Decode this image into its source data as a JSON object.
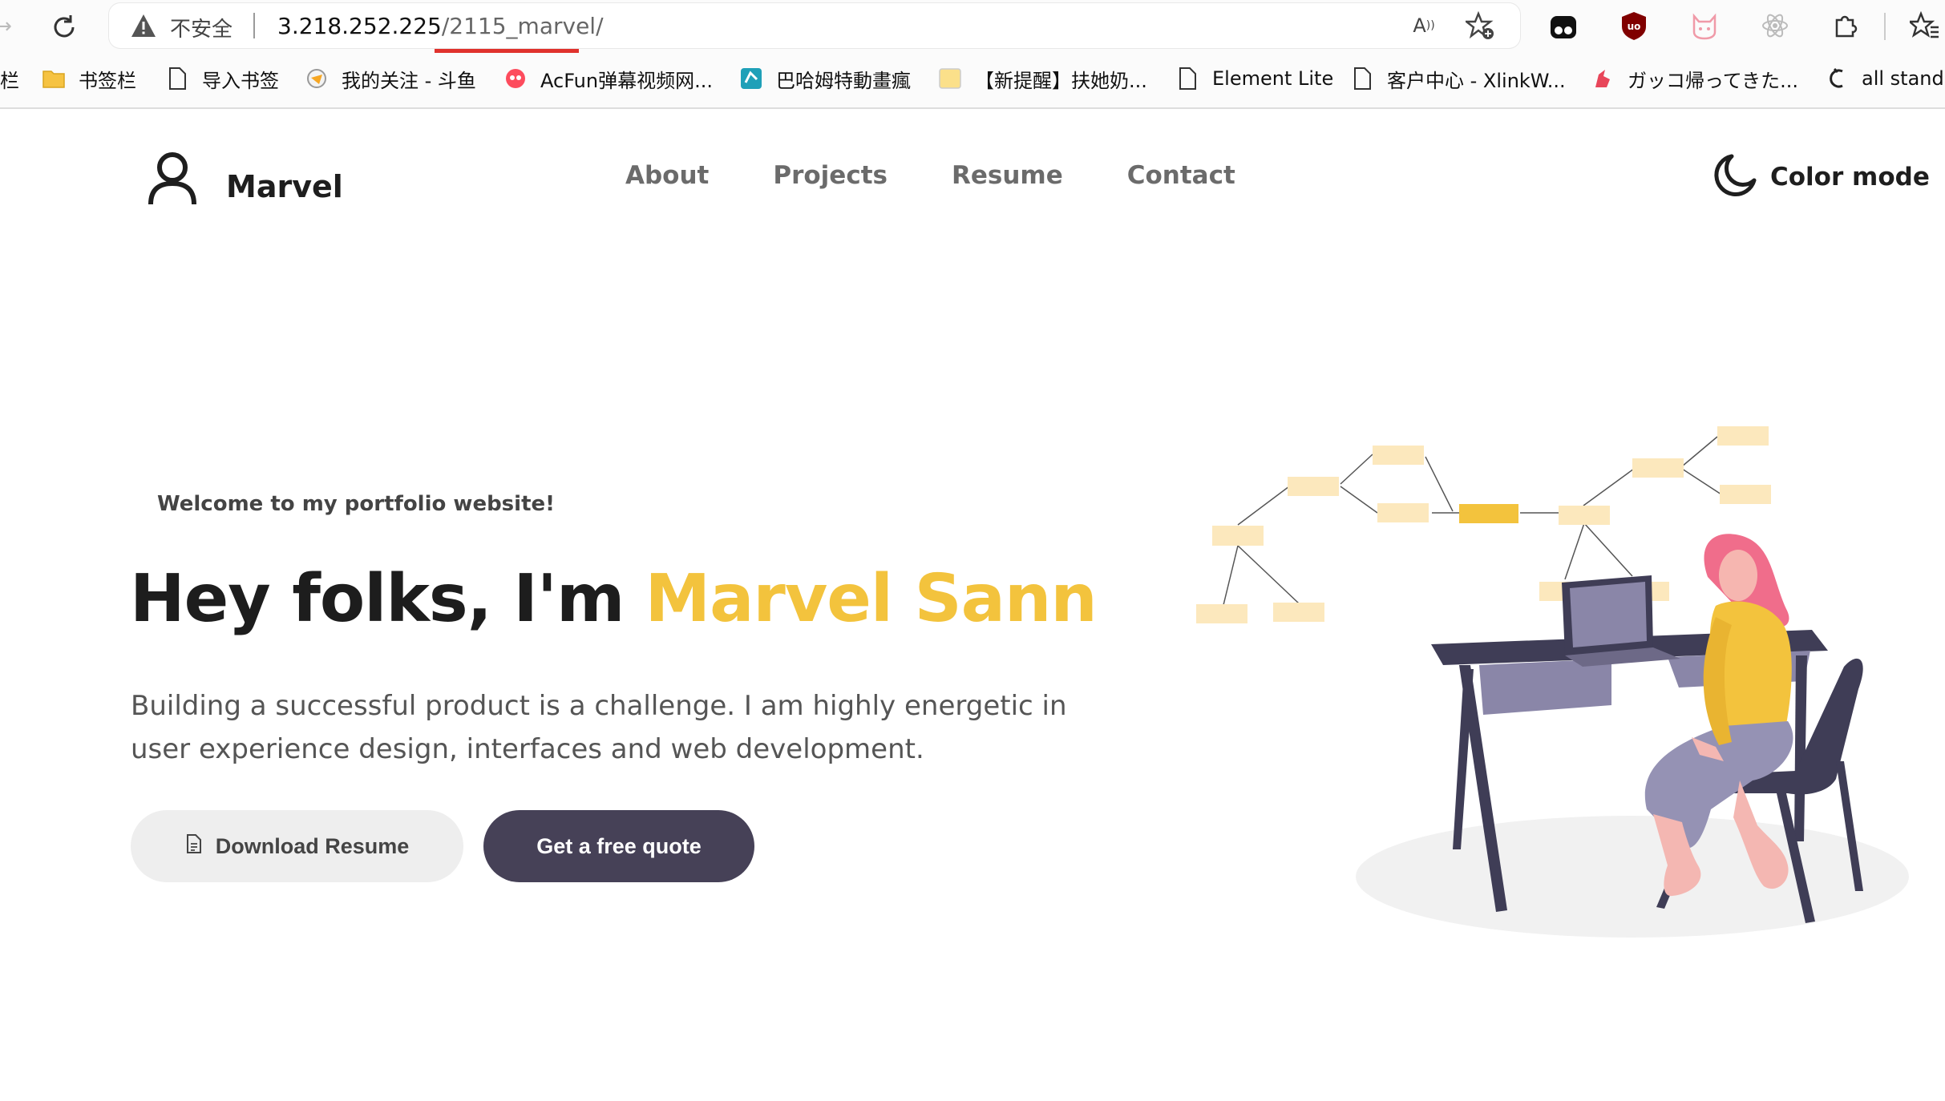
{
  "browser": {
    "insecure_label": "不安全",
    "url_host": "3.218.252.225",
    "url_path": "/2115_marvel/",
    "bookmarks": [
      {
        "label": "栏",
        "icon": "partial-icon"
      },
      {
        "label": "书签栏",
        "icon": "folder-icon"
      },
      {
        "label": "导入书签",
        "icon": "page-icon"
      },
      {
        "label": "我的关注 - 斗鱼",
        "icon": "douyu-icon"
      },
      {
        "label": "AcFun弹幕视频网...",
        "icon": "acfun-icon"
      },
      {
        "label": "巴哈姆特動畫瘋",
        "icon": "bahamut-icon"
      },
      {
        "label": "【新提醒】扶她奶...",
        "icon": "forum-icon"
      },
      {
        "label": "Element Lite",
        "icon": "page-icon"
      },
      {
        "label": "客户中心 - XlinkW...",
        "icon": "page-icon"
      },
      {
        "label": "ガッコ帰ってきた...",
        "icon": "unicorn-icon"
      },
      {
        "label": "all standa",
        "icon": "moon-c-icon"
      }
    ]
  },
  "site": {
    "brand": "Marvel",
    "nav": [
      "About",
      "Projects",
      "Resume",
      "Contact"
    ],
    "color_mode_label": "Color mode"
  },
  "hero": {
    "welcome": "Welcome to my portfolio website!",
    "title_prefix": "Hey folks, I'm",
    "title_name": "Marvel Sann",
    "description": "Building a successful product is a challenge. I am highly energetic in user experience design, interfaces and web development.",
    "download_label": "Download Resume",
    "quote_label": "Get a free quote"
  },
  "colors": {
    "accent": "#f3c33d",
    "dark_button": "#464157",
    "light_button": "#eeeeee"
  }
}
